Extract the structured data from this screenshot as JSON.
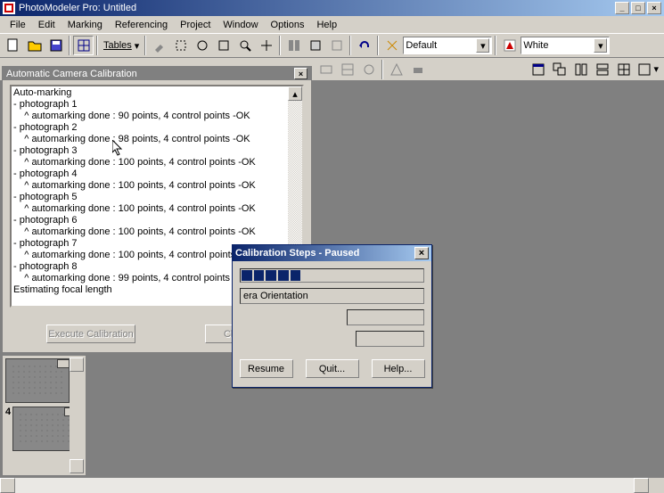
{
  "title": "PhotoModeler Pro: Untitled",
  "menu": [
    "File",
    "Edit",
    "Marking",
    "Referencing",
    "Project",
    "Window",
    "Options",
    "Help"
  ],
  "toolbar": {
    "tables_label": "Tables",
    "combo1": "Default",
    "combo2": "White"
  },
  "panel": {
    "title": "Automatic Camera Calibration",
    "log": [
      "Auto-marking",
      "- photograph 1",
      "    ^ automarking done : 90 points, 4 control points -OK",
      "- photograph 2",
      "    ^ automarking done : 98 points, 4 control points -OK",
      "- photograph 3",
      "    ^ automarking done : 100 points, 4 control points -OK",
      "- photograph 4",
      "    ^ automarking done : 100 points, 4 control points -OK",
      "- photograph 5",
      "    ^ automarking done : 100 points, 4 control points -OK",
      "- photograph 6",
      "    ^ automarking done : 100 points, 4 control points -OK",
      "- photograph 7",
      "    ^ automarking done : 100 points, 4 control points -OK",
      "- photograph 8",
      "    ^ automarking done : 99 points, 4 control points -OK",
      "",
      "Estimating focal length"
    ],
    "exec": "Execute Calibration",
    "close": "Close"
  },
  "dialog": {
    "title": "Calibration Steps - Paused",
    "field1": "era Orientation",
    "resume": "Resume",
    "quit": "Quit...",
    "help": "Help..."
  },
  "thumb_label": "4"
}
